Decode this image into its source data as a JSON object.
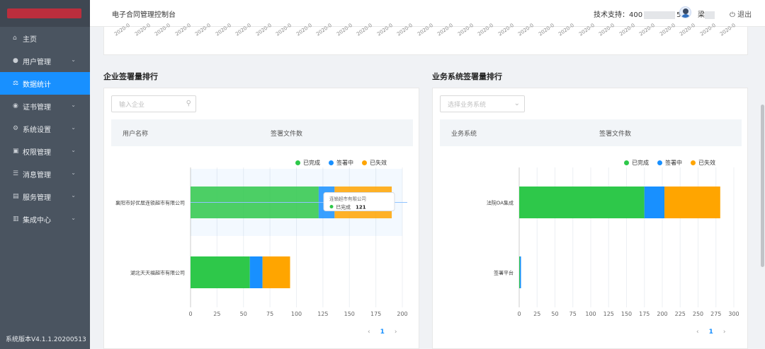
{
  "sidebar": {
    "items": [
      {
        "label": "主页",
        "icon": "home-icon",
        "glyph": "⌂",
        "chevron": false,
        "active": false
      },
      {
        "label": "用户管理",
        "icon": "user-icon",
        "glyph": "●",
        "chevron": true,
        "active": false
      },
      {
        "label": "数据统计",
        "icon": "stats-icon",
        "glyph": "⚖",
        "chevron": false,
        "active": true
      },
      {
        "label": "证书管理",
        "icon": "certificate-icon",
        "glyph": "◉",
        "chevron": true,
        "active": false
      },
      {
        "label": "系统设置",
        "icon": "gear-icon",
        "glyph": "⚙",
        "chevron": true,
        "active": false
      },
      {
        "label": "权限管理",
        "icon": "lock-icon",
        "glyph": "▣",
        "chevron": true,
        "active": false
      },
      {
        "label": "消息管理",
        "icon": "message-icon",
        "glyph": "☰",
        "chevron": true,
        "active": false
      },
      {
        "label": "服务管理",
        "icon": "service-icon",
        "glyph": "▤",
        "chevron": true,
        "active": false
      },
      {
        "label": "集成中心",
        "icon": "integration-icon",
        "glyph": "▥",
        "chevron": true,
        "active": false
      }
    ],
    "version": "系统版本V4.1.1.20200513"
  },
  "header": {
    "title": "电子合同管理控制台",
    "support_label": "技术支持：400",
    "support_suffix": "50",
    "user_name": "梁",
    "logout_label": "⏻ 退出"
  },
  "top_chart": {
    "date_tick": "2020-0",
    "count": 31
  },
  "left_panel": {
    "title": "企业签署量排行",
    "search_placeholder": "输入企业",
    "col_name": "用户名称",
    "col_count": "签署文件数",
    "page": "1"
  },
  "right_panel": {
    "title": "业务系统签署量排行",
    "select_placeholder": "选择业务系统",
    "col_name": "业务系统",
    "col_count": "签署文件数",
    "page": "1"
  },
  "legend": [
    {
      "label": "已完成",
      "color": "#2ec84a"
    },
    {
      "label": "签署中",
      "color": "#1890ff"
    },
    {
      "label": "已失效",
      "color": "#ffa500"
    }
  ],
  "tooltip": {
    "title": "连锁超市有限公司",
    "series": "已完成",
    "value": "121"
  },
  "chart_data": [
    {
      "type": "bar",
      "orientation": "horizontal",
      "stacked": true,
      "categories": [
        "襄阳市好优居连锁超市有限公司",
        "湖北天天福超市有限公司"
      ],
      "series": [
        {
          "name": "已完成",
          "color": "#2ec84a",
          "values": [
            121,
            56
          ]
        },
        {
          "name": "签署中",
          "color": "#1890ff",
          "values": [
            15,
            12
          ]
        },
        {
          "name": "已失效",
          "color": "#ffa500",
          "values": [
            54,
            26
          ]
        }
      ],
      "xticks": [
        0,
        25,
        50,
        75,
        100,
        125,
        150,
        175,
        200
      ],
      "xlim": [
        0,
        200
      ],
      "legend": "top-right",
      "grid": true,
      "highlight": 0
    },
    {
      "type": "bar",
      "orientation": "horizontal",
      "stacked": true,
      "categories": [
        "法院OA集成",
        "签署平台"
      ],
      "series": [
        {
          "name": "已完成",
          "color": "#2ec84a",
          "values": [
            175,
            1
          ]
        },
        {
          "name": "签署中",
          "color": "#1890ff",
          "values": [
            28,
            1
          ]
        },
        {
          "name": "已失效",
          "color": "#ffa500",
          "values": [
            78,
            0
          ]
        }
      ],
      "xticks": [
        0,
        25,
        50,
        75,
        100,
        125,
        150,
        175,
        200,
        225,
        250,
        275,
        300
      ],
      "xlim": [
        0,
        300
      ],
      "legend": "top-right",
      "grid": true,
      "highlight": null
    }
  ]
}
